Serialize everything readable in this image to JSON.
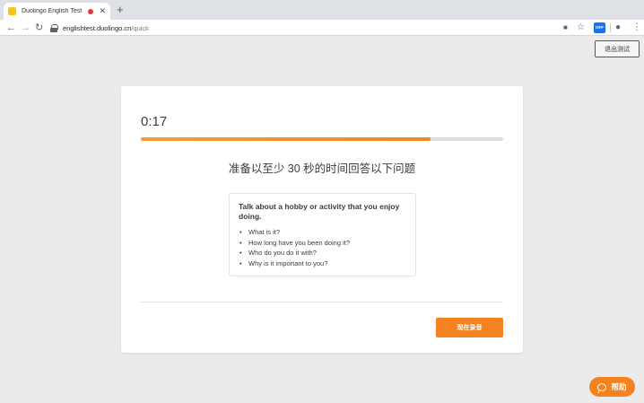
{
  "browser": {
    "tab_title": "Duolingo English Test",
    "tab_close": "✕",
    "new_tab": "+",
    "url_host": "englishtest.duolingo.cn",
    "url_path": "/quick",
    "icons": [
      "back-icon",
      "forward-icon",
      "reload-icon",
      "lock-icon",
      "camera-icon",
      "star-icon",
      "extension-icon",
      "account-icon",
      "menu-icon"
    ],
    "extension_badge": "OFF"
  },
  "page": {
    "exit_label": "退出测试",
    "help_label": "帮助",
    "accent_color": "#f58220"
  },
  "question": {
    "timer": "0:17",
    "progress_fraction": 0.8,
    "instruction": "准备以至少 30 秒的时间回答以下问题",
    "prompt_title": "Talk about a hobby or activity that you enjoy doing.",
    "bullets": [
      "What is it?",
      "How long have you been doing it?",
      "Who do you do it with?",
      "Why is it important to you?"
    ],
    "record_label": "现在录音"
  }
}
